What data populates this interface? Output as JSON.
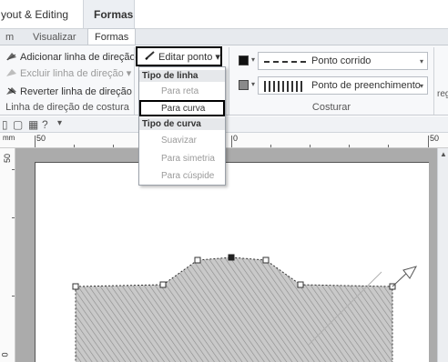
{
  "title_bar": {
    "app_title": "yout & Editing",
    "context_tab": "Formas"
  },
  "tabs": {
    "visualizar": "Visualizar",
    "formas": "Formas",
    "left_fragment": "m"
  },
  "ribbon": {
    "group_direction": {
      "add_label": "Adicionar linha de direção",
      "delete_label": "Excluir linha de direção ▾",
      "reverse_label": "Reverter linha de direção",
      "group_title": "Linha de direção de costura"
    },
    "edit_point_label": "Editar ponto ▾",
    "sewing": {
      "run_stitch_label": "Ponto corrido",
      "fill_stitch_label": "Ponto de preenchimento",
      "group_title": "Costurar",
      "right_fragment": "reg"
    }
  },
  "menu": {
    "line_type_header": "Tipo de linha",
    "to_straight": "Para reta",
    "to_curve": "Para curva",
    "curve_type_header": "Tipo de curva",
    "smooth": "Suavizar",
    "symmetric": "Para simetria",
    "cusp": "Para cúspide"
  },
  "ruler": {
    "h_units": "mm",
    "h_labels": [
      "50",
      "0",
      "50"
    ],
    "v_labels": [
      "50",
      "0"
    ]
  },
  "icons": [
    "add-direction-icon",
    "delete-direction-icon",
    "reverse-direction-icon",
    "pencil-icon",
    "color-swatch-icon",
    "help-icon",
    "arrow-handle-icon"
  ],
  "colors": {
    "accent_selection": "#000000",
    "canvas_background": "#ababab",
    "shape_fill": "#c8c8c8"
  }
}
